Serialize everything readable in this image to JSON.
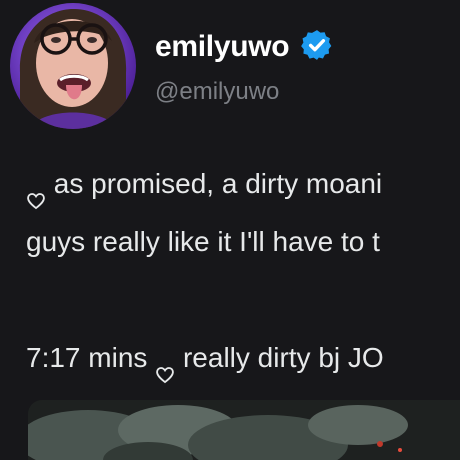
{
  "author": {
    "display_name": "emilyuwo",
    "handle": "@emilyuwo",
    "verified": true,
    "avatar_icon": "profile-avatar",
    "verified_icon": "verified-badge-icon",
    "verified_color": "#1d9bf0"
  },
  "tweet": {
    "line1_text": "as promised, a dirty moani",
    "line2_text": "guys really like it I'll have to t",
    "line3_prefix": "7:17 mins",
    "line3_text": "really dirty bj JO",
    "heart_icon": "heart-outline-icon"
  },
  "media": {
    "icon": "video-thumbnail"
  },
  "colors": {
    "background": "#17171a",
    "text": "#e7e9ea",
    "handle": "#7d8086"
  }
}
